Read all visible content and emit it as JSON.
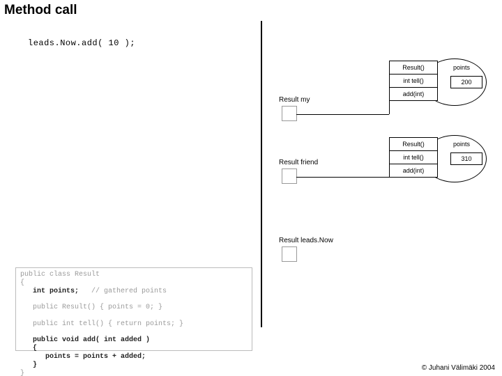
{
  "title": "Method call",
  "call_statement": "leads.Now.add( 10 );",
  "divider": true,
  "objects": {
    "my": {
      "label": "Result my"
    },
    "friend": {
      "label": "Result friend"
    },
    "leads": {
      "label": "Result leads.Now"
    }
  },
  "iface": {
    "rows": [
      "Result()",
      "int tell()",
      "add(int)"
    ]
  },
  "points": {
    "label": "points",
    "my_value": "200",
    "friend_value": "310"
  },
  "code": {
    "l1": "public class Result",
    "l2": "{",
    "l3a": "   ",
    "l3b": "int points;",
    "l3c": "   // gathered points",
    "l5": "   public Result() { points = 0; }",
    "l7": "   public int tell() { return points; }",
    "l9": "   public void add( int added )",
    "l10": "   {",
    "l11": "      points = points + added;",
    "l12": "   }",
    "l13": "}"
  },
  "copyright": "© Juhani Välimäki 2004"
}
